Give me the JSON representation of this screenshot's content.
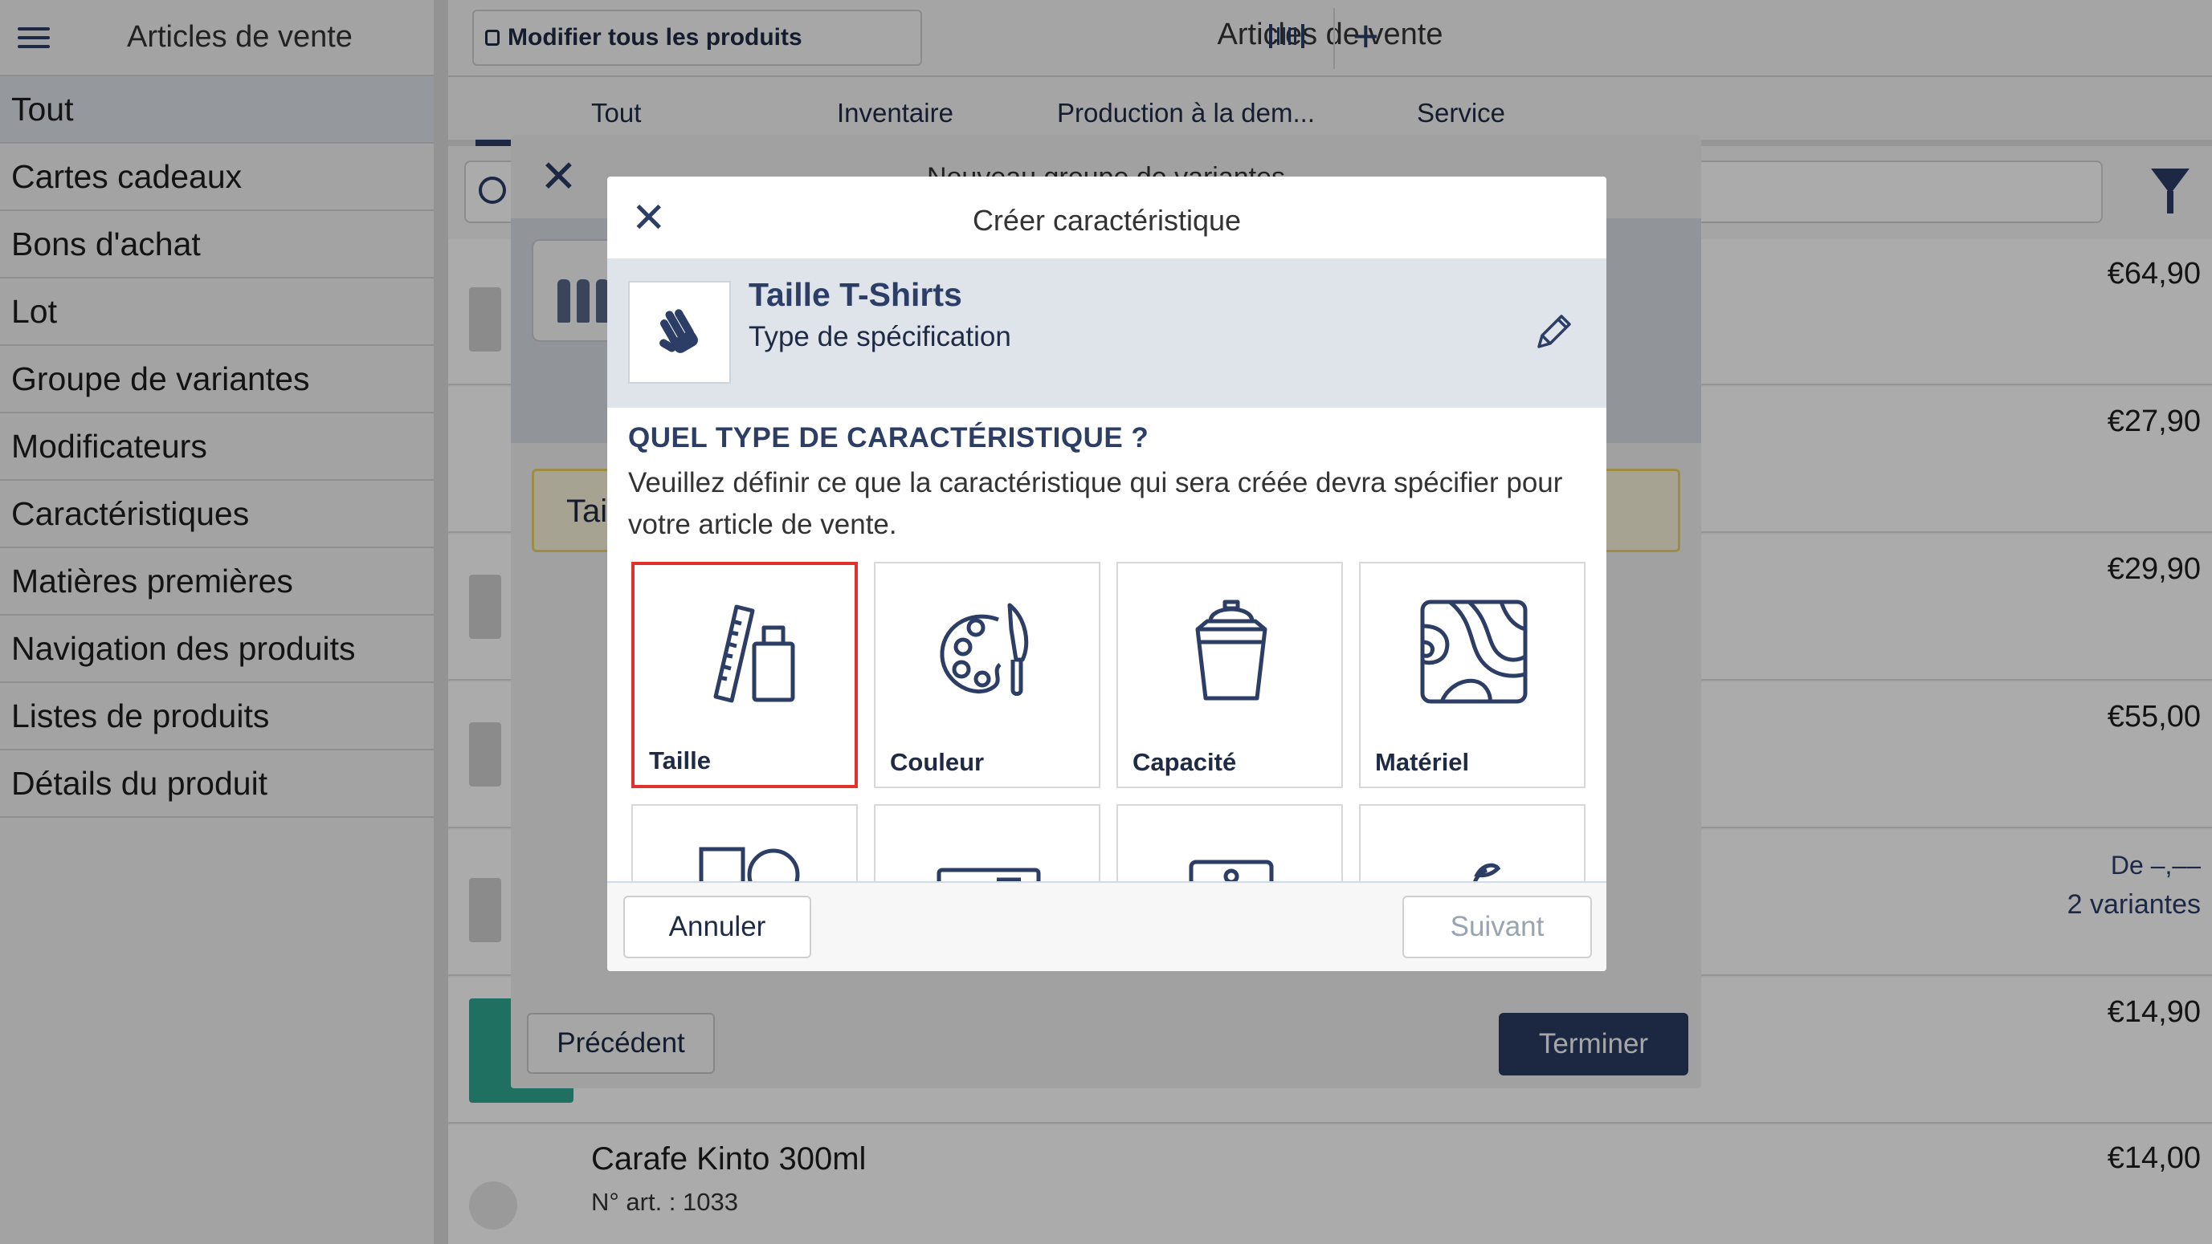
{
  "sidebar": {
    "title": "Articles de vente",
    "items": [
      {
        "label": "Tout"
      },
      {
        "label": "Cartes cadeaux"
      },
      {
        "label": "Bons d'achat"
      },
      {
        "label": "Lot"
      },
      {
        "label": "Groupe de variantes"
      },
      {
        "label": "Modificateurs"
      },
      {
        "label": "Caractéristiques"
      },
      {
        "label": "Matières premières"
      },
      {
        "label": "Navigation des produits"
      },
      {
        "label": "Listes de produits"
      },
      {
        "label": "Détails du produit"
      }
    ]
  },
  "topbar": {
    "edit_all_label": "Modifier tous les produits",
    "title": "Articles de vente"
  },
  "tabs": [
    "Tout",
    "Inventaire",
    "Production à la dem...",
    "Service"
  ],
  "products": {
    "prices": [
      "€64,90",
      "€27,90",
      "€29,90",
      "€55,00"
    ],
    "variant_price_from": "De –,––",
    "variant_count": "2 variantes",
    "price_6": "€14,90",
    "last": {
      "name": "Carafe Kinto 300ml",
      "number": "N° art. : 1033",
      "price": "€14,00"
    }
  },
  "outer_dialog": {
    "title": "Nouveau groupe de variantes",
    "warning_text": "Tai",
    "prev_label": "Précédent",
    "finish_label": "Terminer"
  },
  "dialog": {
    "title": "Créer caractéristique",
    "spec_name": "Taille T-Shirts",
    "spec_type": "Type de spécification",
    "question": "QUEL TYPE DE CARACTÉRISTIQUE ?",
    "description": "Veuillez définir ce que la caractéristique qui sera créée devra spécifier pour votre article de vente.",
    "options": [
      {
        "label": "Taille",
        "icon": "ruler-bottle-icon",
        "selected": true
      },
      {
        "label": "Couleur",
        "icon": "palette-icon",
        "selected": false
      },
      {
        "label": "Capacité",
        "icon": "bucket-icon",
        "selected": false
      },
      {
        "label": "Matériel",
        "icon": "wood-grain-icon",
        "selected": false
      }
    ],
    "cancel_label": "Annuler",
    "next_label": "Suivant"
  },
  "colors": {
    "accent": "#2c3e66",
    "selected_border": "#e0312a",
    "band": "#dfe3ea",
    "warning_bg": "#fffbe2"
  }
}
